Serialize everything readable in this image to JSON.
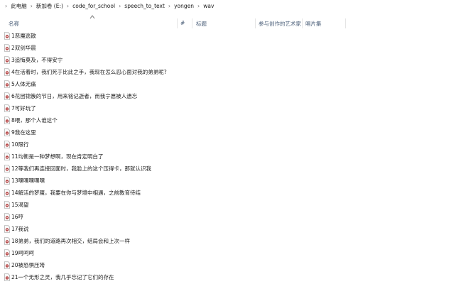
{
  "breadcrumb": [
    "此电脑",
    "新加卷 (E:)",
    "code_for_school",
    "speech_to_text",
    "yongen",
    "wav"
  ],
  "columns": {
    "name": "名称",
    "number": "#",
    "title": "标题",
    "artist": "参与创作的艺术家",
    "album": "唱片集"
  },
  "files": [
    "1恶魔逃散",
    "2双剑华晨",
    "3追悔莫及，不得安宁",
    "4在活着时，我们死于比此之手，我现在怎么忍心面对我的弟弟呢?",
    "5人体无痛",
    "6花团锦簇的节日，用来铭记逝者，而我宁愿被人遗忘",
    "7可好玩了",
    "8喂，那个人谁这个",
    "9我在这里",
    "10限行",
    "11均衡是一种梦想啊，现在肯定明白了",
    "12等我们再连接回面时，我脸上的这个压得卡，那就认识我",
    "13嘿嘿嘿嘿嘿",
    "14解活的梦魇，我要在你与梦境中相遇，之前教育待结",
    "15渴望",
    "16哼",
    "17我说",
    "18弟弟，我们的道路再次相交，结局会和上次一样",
    "19呵呵呵",
    "20被恐惧压垮",
    "21一个无形之灵，我几乎忘记了它们的存在"
  ]
}
